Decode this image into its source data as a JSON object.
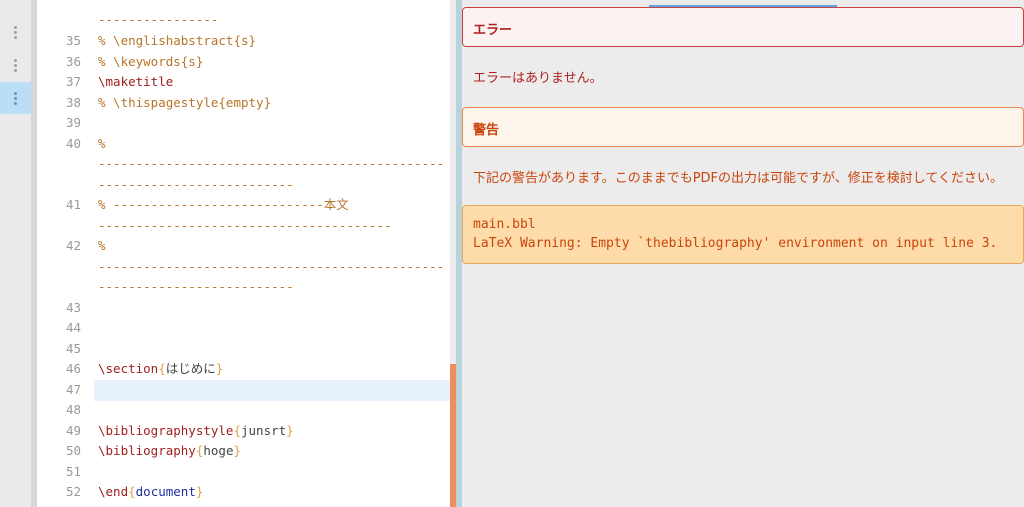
{
  "editor": {
    "top_fragment": "----------------",
    "lines": [
      {
        "num": "35",
        "text": "% \\englishabstract{s}"
      },
      {
        "num": "36",
        "text": "% \\keywords{s}"
      },
      {
        "num": "37",
        "text": "\\maketitle"
      },
      {
        "num": "38",
        "text": "% \\thispagestyle{empty}"
      },
      {
        "num": "39",
        "text": ""
      },
      {
        "num": "40",
        "text": "%",
        "cont1": "----------------------------------------------",
        "cont2": "--------------------------"
      },
      {
        "num": "41",
        "text": "% ----------------------------本文",
        "cont1": "---------------------------------------"
      },
      {
        "num": "42",
        "text": "%",
        "cont1": "----------------------------------------------",
        "cont2": "--------------------------"
      },
      {
        "num": "43",
        "text": ""
      },
      {
        "num": "44",
        "text": ""
      },
      {
        "num": "45",
        "text": ""
      },
      {
        "num": "46",
        "cmd": "\\section",
        "arg": "はじめに"
      },
      {
        "num": "47",
        "text": ""
      },
      {
        "num": "48",
        "text": ""
      },
      {
        "num": "49",
        "cmd": "\\bibliographystyle",
        "arg": "junsrt"
      },
      {
        "num": "50",
        "cmd": "\\bibliography",
        "arg": "hoge"
      },
      {
        "num": "51",
        "text": ""
      },
      {
        "num": "52",
        "cmd": "\\end",
        "arg": "document"
      }
    ]
  },
  "errors": {
    "title": "エラー",
    "message": "エラーはありません。"
  },
  "warnings": {
    "title": "警告",
    "message": "下記の警告があります。このままでもPDFの出力は可能ですが、修正を検討してください。",
    "items": [
      {
        "file": "main.bbl",
        "text": "LaTeX Warning: Empty `thebibliography' environment on input line 3."
      }
    ]
  }
}
